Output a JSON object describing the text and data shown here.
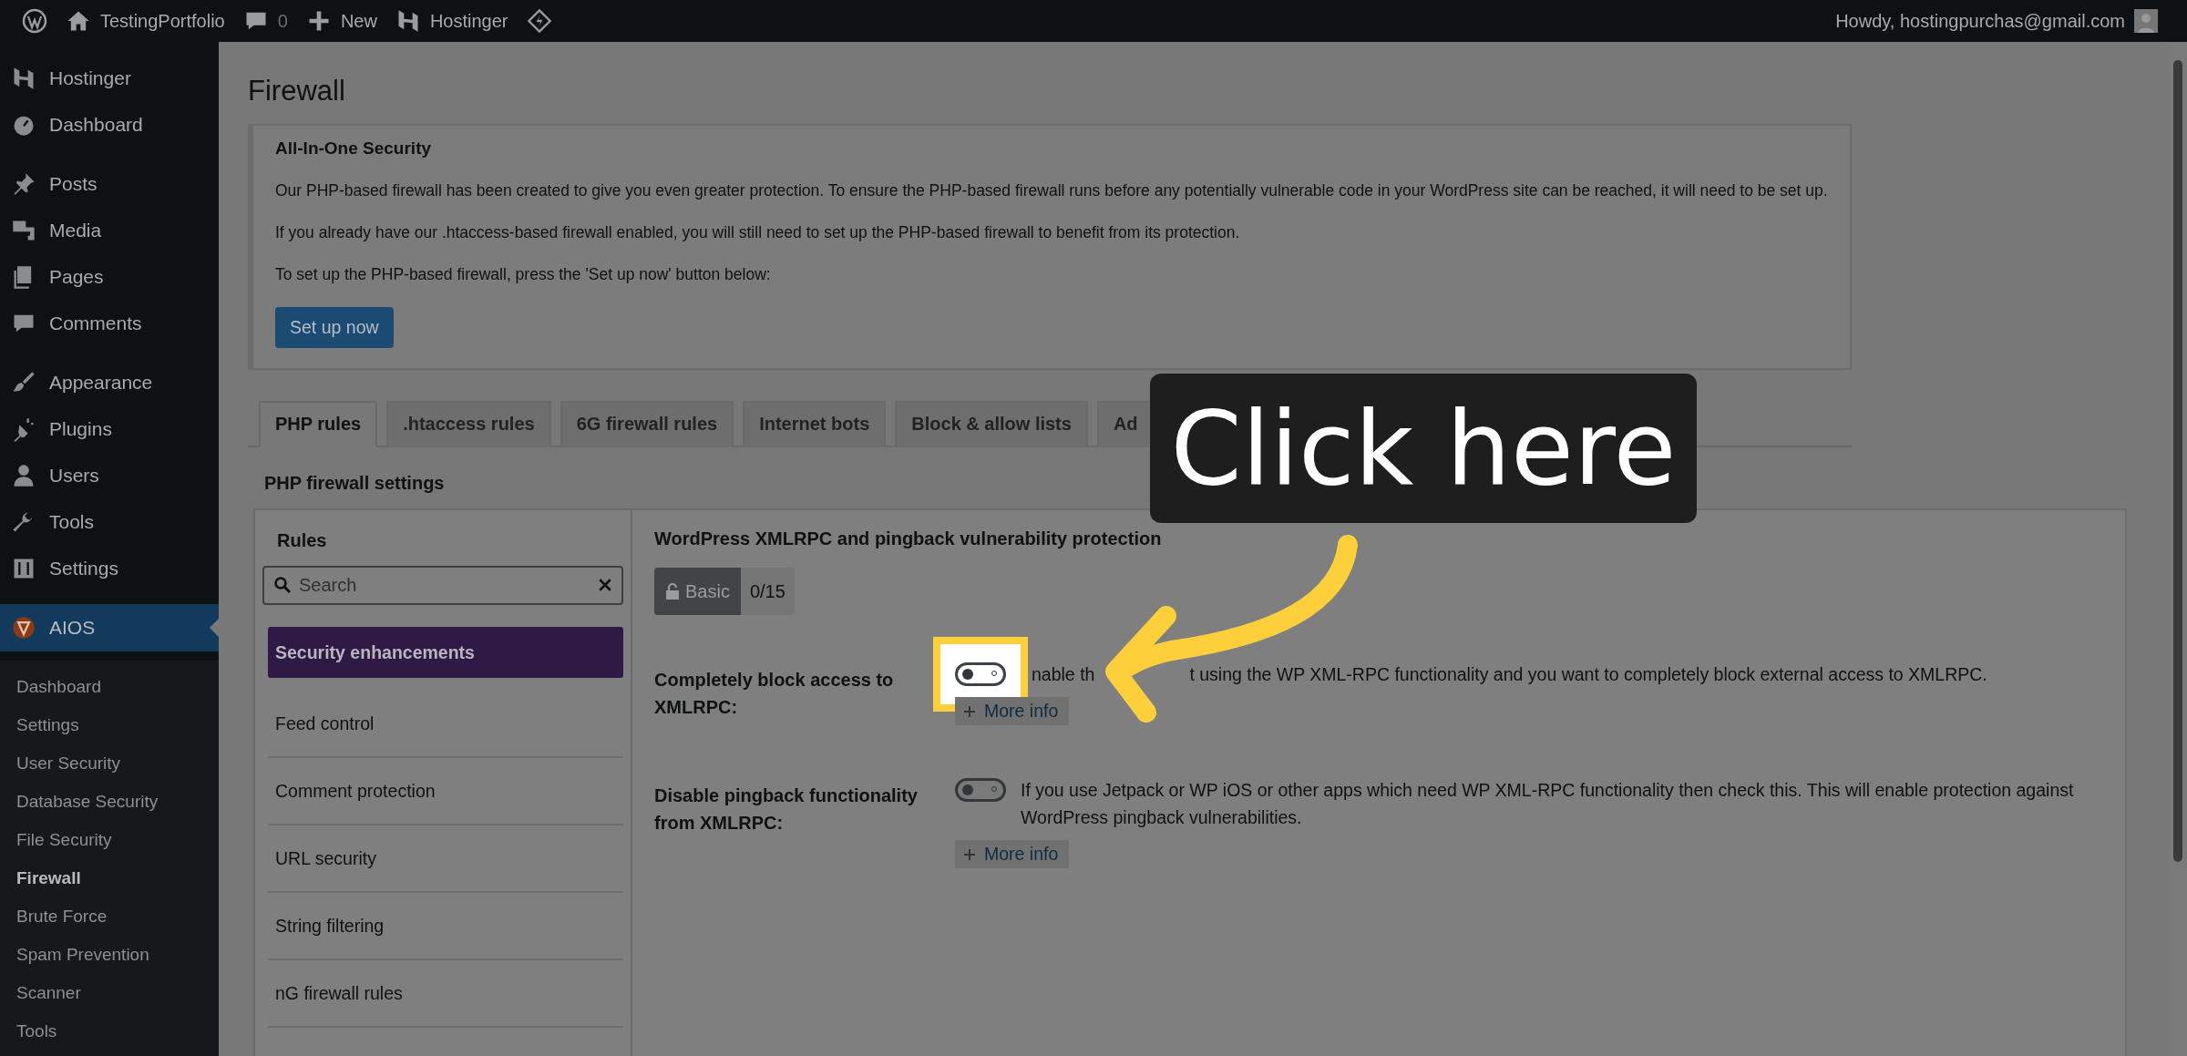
{
  "admin_bar": {
    "site": "TestingPortfolio",
    "comments": "0",
    "new": "New",
    "hostinger": "Hostinger",
    "account": "Howdy, hostingpurchas@gmail.com"
  },
  "sidebar": {
    "groups": [
      [
        {
          "label": "Hostinger",
          "selected": false
        },
        {
          "label": "Dashboard",
          "selected": false
        }
      ],
      [
        {
          "label": "Posts",
          "selected": false
        },
        {
          "label": "Media",
          "selected": false
        },
        {
          "label": "Pages",
          "selected": false
        },
        {
          "label": "Comments",
          "selected": false
        }
      ],
      [
        {
          "label": "Appearance",
          "selected": false
        },
        {
          "label": "Plugins",
          "selected": false
        },
        {
          "label": "Users",
          "selected": false
        },
        {
          "label": "Tools",
          "selected": false
        },
        {
          "label": "Settings",
          "selected": false
        }
      ],
      [
        {
          "label": "AIOS",
          "selected": true
        }
      ]
    ],
    "submenu": [
      {
        "label": "Dashboard",
        "selected": false
      },
      {
        "label": "Settings",
        "selected": false
      },
      {
        "label": "User Security",
        "selected": false
      },
      {
        "label": "Database Security",
        "selected": false
      },
      {
        "label": "File Security",
        "selected": false
      },
      {
        "label": "Firewall",
        "selected": true
      },
      {
        "label": "Brute Force",
        "selected": false
      },
      {
        "label": "Spam Prevention",
        "selected": false
      },
      {
        "label": "Scanner",
        "selected": false
      },
      {
        "label": "Tools",
        "selected": false
      }
    ]
  },
  "page": {
    "title": "Firewall"
  },
  "notice": {
    "heading": "All-In-One Security",
    "paragraphs": [
      "Our PHP-based firewall has been created to give you even greater protection. To ensure the PHP-based firewall runs before any potentially vulnerable code in your WordPress site can be reached, it will need to be set up.",
      "If you already have our .htaccess-based firewall enabled, you will still need to set up the PHP-based firewall to benefit from its protection.",
      "To set up the PHP-based firewall, press the 'Set up now' button below:"
    ],
    "button": "Set up now"
  },
  "tabs": [
    {
      "label": "PHP rules",
      "selected": true
    },
    {
      "label": ".htaccess rules",
      "selected": false
    },
    {
      "label": "6G firewall rules",
      "selected": false
    },
    {
      "label": "Internet bots",
      "selected": false
    },
    {
      "label": "Block & allow lists",
      "selected": false
    },
    {
      "label": "Ad",
      "selected": false
    }
  ],
  "section_title": "PHP firewall settings",
  "rules": {
    "heading": "Rules",
    "search": {
      "placeholder": "Search"
    },
    "items": [
      {
        "label": "Security enhancements",
        "selected": true
      },
      {
        "label": "Feed control",
        "selected": false
      },
      {
        "label": "Comment protection",
        "selected": false
      },
      {
        "label": "URL security",
        "selected": false
      },
      {
        "label": "String filtering",
        "selected": false
      },
      {
        "label": "nG firewall rules",
        "selected": false
      }
    ]
  },
  "detail": {
    "heading": "WordPress XMLRPC and pingback vulnerability protection",
    "badge": {
      "label": "Basic",
      "count": "0/15"
    },
    "settings": [
      {
        "label": "Completely block access to XMLRPC:",
        "on": false,
        "highlighted": true,
        "description_parts": [
          "nable th",
          "t using the WP XML-RPC functionality and you want to completely block external access to XMLRPC."
        ],
        "more": "More info"
      },
      {
        "label": "Disable pingback functionality from XMLRPC:",
        "on": false,
        "highlighted": false,
        "description_parts": [
          "If you use Jetpack or WP iOS or other apps which need WP XML-RPC functionality then check this. This will enable protection against WordPress pingback vulnerabilities."
        ],
        "more": "More info"
      }
    ]
  },
  "callout": {
    "text": "Click here"
  }
}
